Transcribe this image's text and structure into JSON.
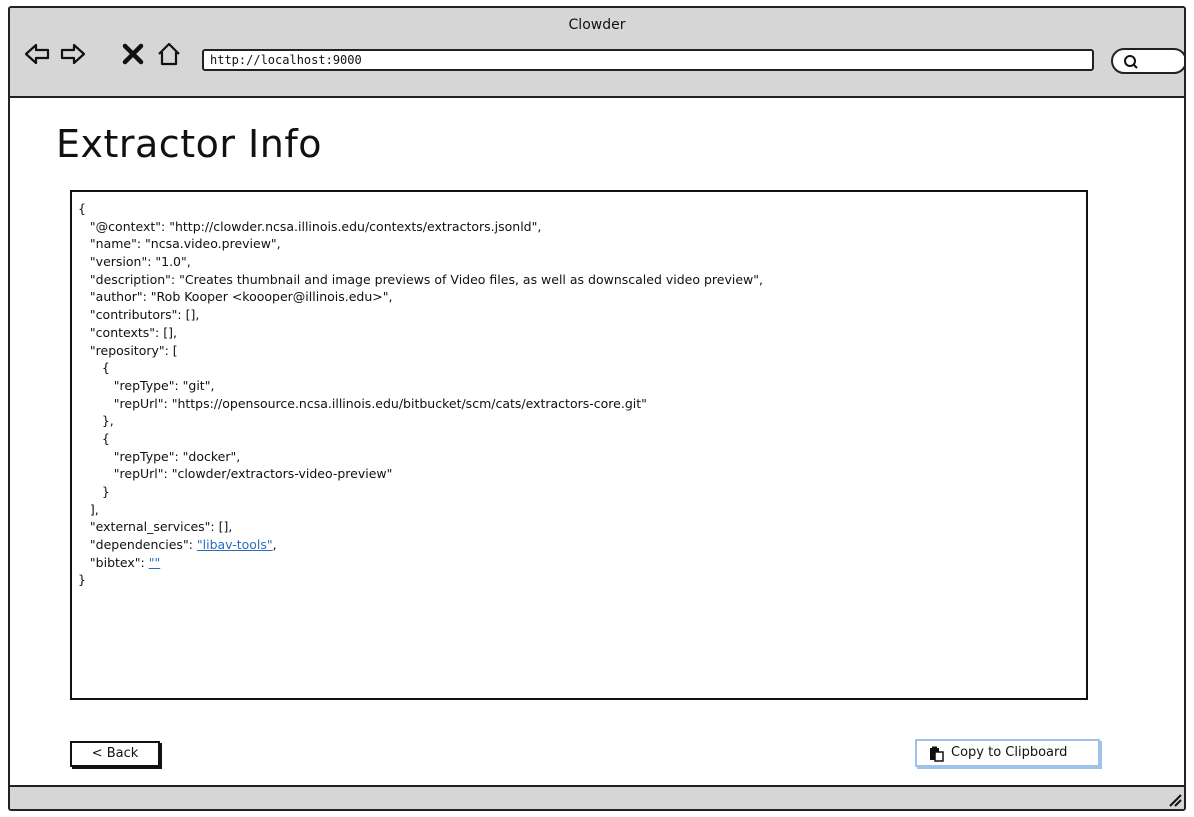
{
  "window": {
    "title": "Clowder",
    "url": "http://localhost:9000"
  },
  "toolbar": {
    "back_icon": "arrow-left-icon",
    "forward_icon": "arrow-right-icon",
    "stop_icon": "close-icon",
    "home_icon": "home-icon",
    "search_icon": "search-icon"
  },
  "page": {
    "title": "Extractor Info"
  },
  "json_lines": [
    "{",
    "   \"@context\": \"http://clowder.ncsa.illinois.edu/contexts/extractors.jsonld\",",
    "   \"name\": \"ncsa.video.preview\",",
    "   \"version\": \"1.0\",",
    "   \"description\": \"Creates thumbnail and image previews of Video files, as well as downscaled video preview\",",
    "   \"author\": \"Rob Kooper <koooper@illinois.edu>\",",
    "   \"contributors\": [],",
    "   \"contexts\": [],",
    "   \"repository\": [",
    "      {",
    "         \"repType\": \"git\",",
    "         \"repUrl\": \"https://opensource.ncsa.illinois.edu/bitbucket/scm/cats/extractors-core.git\"",
    "      },",
    "      {",
    "         \"repType\": \"docker\",",
    "         \"repUrl\": \"clowder/extractors-video-preview\"",
    "      }",
    "   ],",
    "   \"external_services\": [],"
  ],
  "dependencies": {
    "prefix": "   \"dependencies\": ",
    "link": "\"libav-tools\"",
    "suffix": ","
  },
  "bibtex": {
    "prefix": "   \"bibtex\": ",
    "link": "\"\""
  },
  "closing": "}",
  "buttons": {
    "back_label": "< Back",
    "copy_label": "Copy to Clipboard",
    "copy_icon": "clipboard-icon"
  },
  "colors": {
    "link": "#2a6ebb",
    "chrome": "#d6d6d6",
    "copy_button_border": "#9ec2ea"
  }
}
